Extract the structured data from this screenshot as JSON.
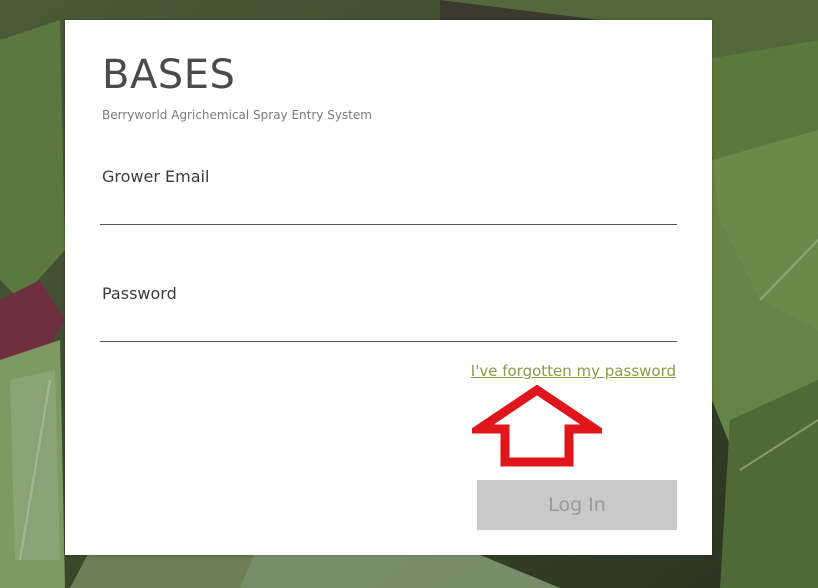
{
  "app": {
    "title": "BASES",
    "subtitle": "Berryworld Agrichemical Spray Entry System"
  },
  "form": {
    "email_label": "Grower Email",
    "email_value": "",
    "email_placeholder": "",
    "password_label": "Password",
    "password_value": "",
    "password_placeholder": "",
    "forgot_password_link": "I've forgotten my password",
    "login_button": "Log In"
  },
  "annotation": {
    "arrow_color": "#e0161c",
    "arrow_direction": "up"
  },
  "colors": {
    "link": "#8a9a4a",
    "button_bg": "#c9c9c9",
    "button_text": "#9a9a9a"
  }
}
